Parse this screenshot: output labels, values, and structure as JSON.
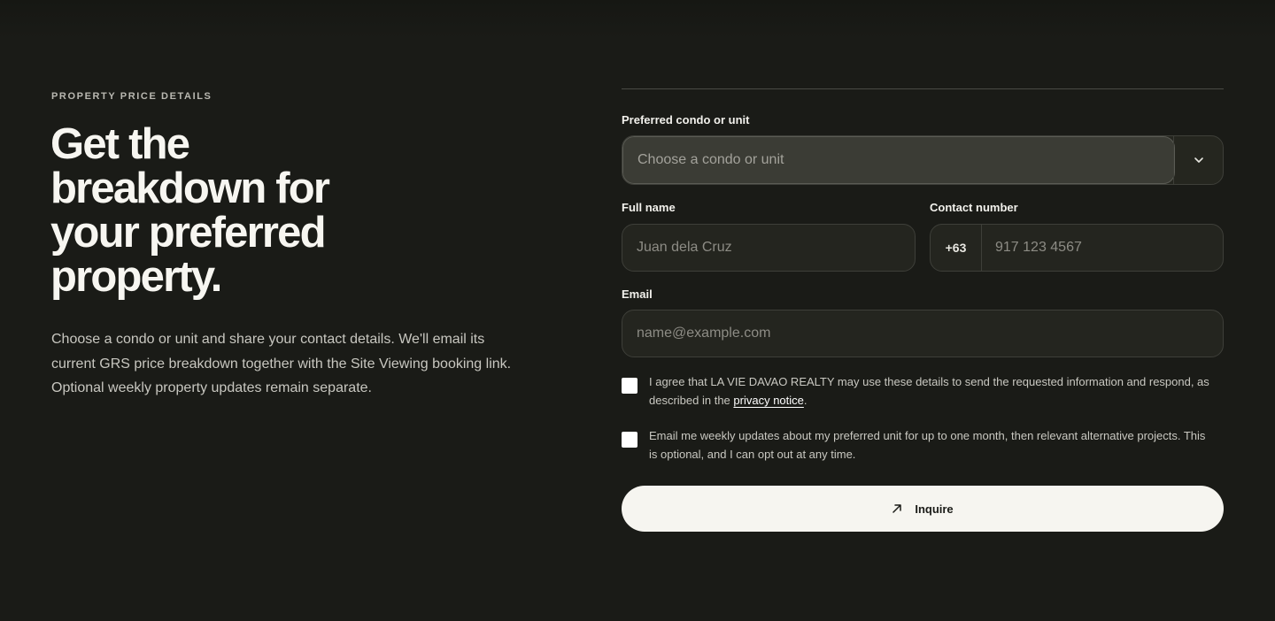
{
  "left": {
    "eyebrow": "PROPERTY PRICE DETAILS",
    "headline": "Get the breakdown for your preferred property.",
    "intro": "Choose a condo or unit and share your contact details. We'll email its current GRS price breakdown together with the Site Viewing booking link. Optional weekly property updates remain separate."
  },
  "form": {
    "unit": {
      "label": "Preferred condo or unit",
      "placeholder": "Choose a condo or unit",
      "icon": "chevron-down-icon"
    },
    "full_name": {
      "label": "Full name",
      "placeholder": "Juan dela Cruz"
    },
    "contact": {
      "label": "Contact number",
      "prefix": "+63",
      "placeholder": "917 123 4567"
    },
    "email": {
      "label": "Email",
      "placeholder": "name@example.com"
    },
    "consent": {
      "text_before": "I agree that LA VIE DAVAO REALTY may use these details to send the requested information and respond, as described in the ",
      "link": "privacy notice",
      "text_after": "."
    },
    "updates": {
      "text": "Email me weekly updates about my preferred unit for up to one month, then relevant alternative projects. This is optional, and I can opt out at any time."
    },
    "submit": {
      "label": "Inquire",
      "icon": "arrow-up-right-icon"
    }
  },
  "colors": {
    "background": "#1a1b17",
    "field": "#24251f",
    "button": "#f6f5f0",
    "text": "#f4f3ee"
  }
}
